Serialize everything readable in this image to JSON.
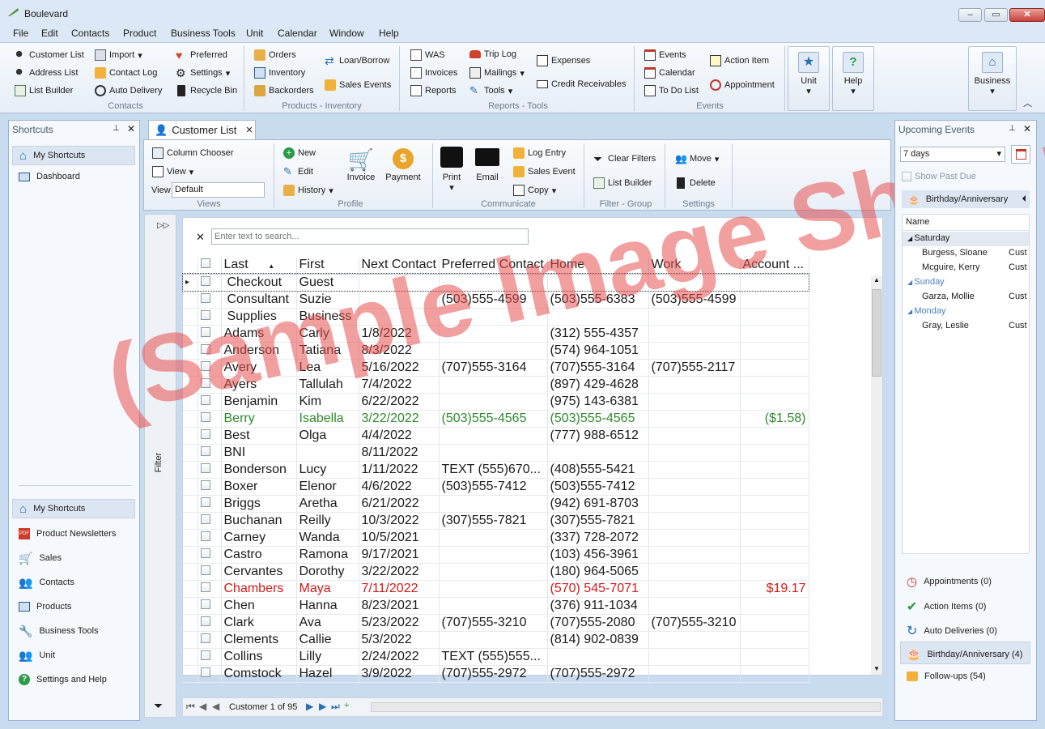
{
  "app": {
    "title": "Boulevard",
    "min": "–",
    "max": "▭",
    "close": "✕"
  },
  "menu": [
    "File",
    "Edit",
    "Contacts",
    "Product",
    "Business Tools",
    "Unit",
    "Calendar",
    "Window",
    "Help"
  ],
  "ribbon": {
    "contacts": {
      "customer_list": "Customer List",
      "address_list": "Address List",
      "list_builder": "List Builder",
      "import": "Import",
      "contact_log": "Contact Log",
      "auto_delivery": "Auto Delivery",
      "preferred": "Preferred",
      "settings": "Settings",
      "recycle_bin": "Recycle Bin",
      "label": "Contacts"
    },
    "products": {
      "orders": "Orders",
      "inventory": "Inventory",
      "backorders": "Backorders",
      "loan_borrow": "Loan/Borrow",
      "sales_events": "Sales Events",
      "label": "Products - Inventory"
    },
    "reports": {
      "was": "WAS",
      "invoices": "Invoices",
      "reports": "Reports",
      "trip_log": "Trip Log",
      "mailings": "Mailings",
      "tools": "Tools",
      "expenses": "Expenses",
      "credit_receivables": "Credit Receivables",
      "label": "Reports - Tools"
    },
    "events": {
      "events": "Events",
      "calendar": "Calendar",
      "todo": "To Do List",
      "action_item": "Action Item",
      "appointment": "Appointment",
      "label": "Events"
    },
    "unit": "Unit",
    "help": "Help",
    "business": "Business"
  },
  "shortcuts": {
    "title": "Shortcuts",
    "top_items": [
      "My Shortcuts",
      "Dashboard"
    ],
    "bottom_items": [
      "My Shortcuts",
      "Product Newsletters",
      "Sales",
      "Contacts",
      "Products",
      "Business Tools",
      "Unit",
      "Settings and Help"
    ]
  },
  "tab": {
    "label": "Customer List"
  },
  "subribbon": {
    "column_chooser": "Column Chooser",
    "view": "View",
    "view_label": "View",
    "view_value": "Default",
    "views_label": "Views",
    "new": "New",
    "edit": "Edit",
    "history": "History",
    "invoice": "Invoice",
    "payment": "Payment",
    "profile_label": "Profile",
    "print": "Print",
    "email": "Email",
    "log_entry": "Log Entry",
    "sales_event": "Sales Event",
    "copy": "Copy",
    "communicate_label": "Communicate",
    "clear_filters": "Clear Filters",
    "list_builder": "List Builder",
    "filter_group_label": "Filter - Group",
    "move": "Move",
    "delete": "Delete",
    "settings_label": "Settings"
  },
  "filter_label": "Filter",
  "search": {
    "placeholder": "Enter text to search..."
  },
  "grid": {
    "columns": [
      "Last",
      "First",
      "Next Contact",
      "Preferred Contact",
      "Home",
      "Work",
      "Account ..."
    ],
    "rows": [
      [
        "Checkout",
        "Guest",
        "",
        "",
        "",
        "",
        ""
      ],
      [
        "Consultant",
        "Suzie",
        "",
        "(503)555-4599",
        "(503)555-6383",
        "(503)555-4599",
        ""
      ],
      [
        "Supplies",
        "Business",
        "",
        "",
        "",
        "",
        ""
      ],
      [
        "Adams",
        "Carly",
        "1/8/2022",
        "",
        "(312) 555-4357",
        "",
        ""
      ],
      [
        "Anderson",
        "Tatiana",
        "8/3/2022",
        "",
        "(574) 964-1051",
        "",
        ""
      ],
      [
        "Avery",
        "Lea",
        "5/16/2022",
        "(707)555-3164",
        "(707)555-3164",
        "(707)555-2117",
        ""
      ],
      [
        "Ayers",
        "Tallulah",
        "7/4/2022",
        "",
        "(897) 429-4628",
        "",
        ""
      ],
      [
        "Benjamin",
        "Kim",
        "6/22/2022",
        "",
        "(975) 143-6381",
        "",
        ""
      ],
      [
        "Berry",
        "Isabella",
        "3/22/2022",
        "(503)555-4565",
        "(503)555-4565",
        "",
        "($1.58)"
      ],
      [
        "Best",
        "Olga",
        "4/4/2022",
        "",
        "(777) 988-6512",
        "",
        ""
      ],
      [
        "BNI",
        "",
        "8/11/2022",
        "",
        "",
        "",
        ""
      ],
      [
        "Bonderson",
        "Lucy",
        "1/11/2022",
        "TEXT (555)670...",
        "(408)555-5421",
        "",
        ""
      ],
      [
        "Boxer",
        "Elenor",
        "4/6/2022",
        "(503)555-7412",
        "(503)555-7412",
        "",
        ""
      ],
      [
        "Briggs",
        "Aretha",
        "6/21/2022",
        "",
        "(942) 691-8703",
        "",
        ""
      ],
      [
        "Buchanan",
        "Reilly",
        "10/3/2022",
        "(307)555-7821",
        "(307)555-7821",
        "",
        ""
      ],
      [
        "Carney",
        "Wanda",
        "10/5/2021",
        "",
        "(337) 728-2072",
        "",
        ""
      ],
      [
        "Castro",
        "Ramona",
        "9/17/2021",
        "",
        "(103) 456-3961",
        "",
        ""
      ],
      [
        "Cervantes",
        "Dorothy",
        "3/22/2022",
        "",
        "(180) 964-5065",
        "",
        ""
      ],
      [
        "Chambers",
        "Maya",
        "7/11/2022",
        "",
        "(570) 545-7071",
        "",
        "$19.17"
      ],
      [
        "Chen",
        "Hanna",
        "8/23/2021",
        "",
        "(376) 911-1034",
        "",
        ""
      ],
      [
        "Clark",
        "Ava",
        "5/23/2022",
        "(707)555-3210",
        "(707)555-2080",
        "(707)555-3210",
        ""
      ],
      [
        "Clements",
        "Callie",
        "5/3/2022",
        "",
        "(814) 902-0839",
        "",
        ""
      ],
      [
        "Collins",
        "Lilly",
        "2/24/2022",
        "TEXT (555)555...",
        "",
        "",
        ""
      ],
      [
        "Comstock",
        "Hazel",
        "3/9/2022",
        "(707)555-2972",
        "(707)555-2972",
        "",
        ""
      ]
    ]
  },
  "pager": {
    "text": "Customer 1 of 95"
  },
  "upcoming": {
    "title": "Upcoming Events",
    "range": "7 days",
    "show_past_due": "Show Past Due",
    "section": "Birthday/Anniversary",
    "col_name": "Name",
    "groups": [
      {
        "day": "Saturday",
        "items": [
          {
            "name": "Burgess, Sloane",
            "type": "Cust"
          },
          {
            "name": "Mcguire, Kerry",
            "type": "Cust"
          }
        ]
      },
      {
        "day": "Sunday",
        "items": [
          {
            "name": "Garza, Mollie",
            "type": "Cust"
          }
        ]
      },
      {
        "day": "Monday",
        "items": [
          {
            "name": "Gray, Leslie",
            "type": "Cust"
          }
        ]
      }
    ],
    "summary": [
      "Appointments (0)",
      "Action Items (0)",
      "Auto Deliveries (0)",
      "Birthday/Anniversary (4)",
      "Follow-ups (54)"
    ]
  },
  "watermark": "(Sample Image Shown)",
  "colors": {
    "accent": "#3a6fb0",
    "green_row": "#2e8b2e",
    "red_row": "#d21a1a"
  }
}
